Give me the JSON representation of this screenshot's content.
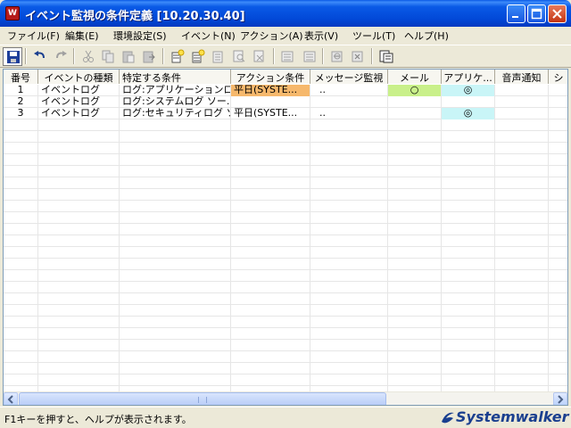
{
  "window": {
    "title": "イベント監視の条件定義 [10.20.30.40]",
    "icon_text": "W"
  },
  "menu": [
    {
      "label": "ファイル(F)"
    },
    {
      "label": "編集(E)"
    },
    {
      "label": "環境設定(S)"
    },
    {
      "label": "イベント(N)"
    },
    {
      "label": "アクション(A)"
    },
    {
      "label": "表示(V)"
    },
    {
      "label": "ツール(T)"
    },
    {
      "label": "ヘルプ(H)"
    }
  ],
  "toolbar": {
    "icons": [
      "save-icon",
      "undo-icon",
      "redo-icon",
      "cut-icon",
      "copy-icon",
      "paste-icon",
      "paste-special-icon",
      "add-event-icon",
      "add-condition-icon",
      "delete-condition-icon",
      "find-icon",
      "find-next-icon",
      "move-up-icon",
      "move-down-icon",
      "import-icon",
      "export-icon",
      "preview-icon"
    ]
  },
  "table": {
    "columns": [
      "番号",
      "イベントの種類",
      "特定する条件",
      "アクション条件",
      "メッセージ監視",
      "メール",
      "アプリケ...",
      "音声通知",
      "シ"
    ],
    "rows": [
      {
        "no": "1",
        "type": "イベントログ",
        "condition": "ログ:アプリケーションロ...",
        "action": "平日(SYSTE...",
        "message": "..",
        "mail": "○",
        "app": "◎",
        "sound": "",
        "extra": ""
      },
      {
        "no": "2",
        "type": "イベントログ",
        "condition": "ログ:システムログ ソー...",
        "action": "",
        "message": "",
        "mail": "",
        "app": "",
        "sound": "",
        "extra": ""
      },
      {
        "no": "3",
        "type": "イベントログ",
        "condition": "ログ:セキュリティログ ソ...",
        "action": "平日(SYSTE...",
        "message": "..",
        "mail": "",
        "app": "◎",
        "sound": "",
        "extra": ""
      }
    ],
    "highlight_colors": {
      "action_row1": "#f6b86c",
      "mail_row1": "#c9f08a",
      "app_cell": "#c9f5f7"
    }
  },
  "status": {
    "text": "F1キーを押すと、ヘルプが表示されます。",
    "logo_text": "Systemwalker"
  }
}
